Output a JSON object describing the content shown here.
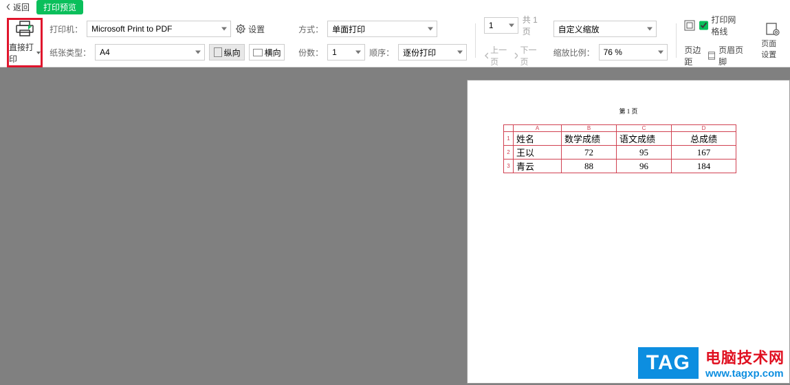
{
  "header": {
    "back_label": "返回",
    "title": "打印预览"
  },
  "toolbar": {
    "direct_print": "直接打印",
    "printer_label": "打印机：",
    "printer_value": "Microsoft Print to PDF",
    "paper_label": "纸张类型：",
    "paper_value": "A4",
    "settings": "设置",
    "orient_portrait": "纵向",
    "orient_landscape": "横向",
    "mode_label": "方式：",
    "mode_value": "单面打印",
    "copies_label": "份数：",
    "copies_value": "1",
    "order_label": "顺序：",
    "order_value": "逐份打印",
    "page_value": "1",
    "page_total": "共 1 页",
    "prev_page": "上一页",
    "next_page": "下一页",
    "zoom_mode": "自定义缩放",
    "zoom_ratio_label": "缩放比例：",
    "zoom_ratio_value": "76 %",
    "print_grid": "打印网格线",
    "page_margin": "页边距",
    "header_footer": "页眉页脚",
    "page_setup": "页面设置"
  },
  "page": {
    "page_num_text": "第 1 页",
    "cols": [
      "A",
      "B",
      "C",
      "D"
    ],
    "rows_idx": [
      "1",
      "2",
      "3"
    ],
    "data": [
      [
        "姓名",
        "数学成绩",
        "语文成绩",
        "总成绩"
      ],
      [
        "王以",
        "72",
        "95",
        "167"
      ],
      [
        "青云",
        "88",
        "96",
        "184"
      ]
    ]
  },
  "watermark": {
    "logo": "TAG",
    "cn": "电脑技术网",
    "url": "www.tagxp.com"
  }
}
